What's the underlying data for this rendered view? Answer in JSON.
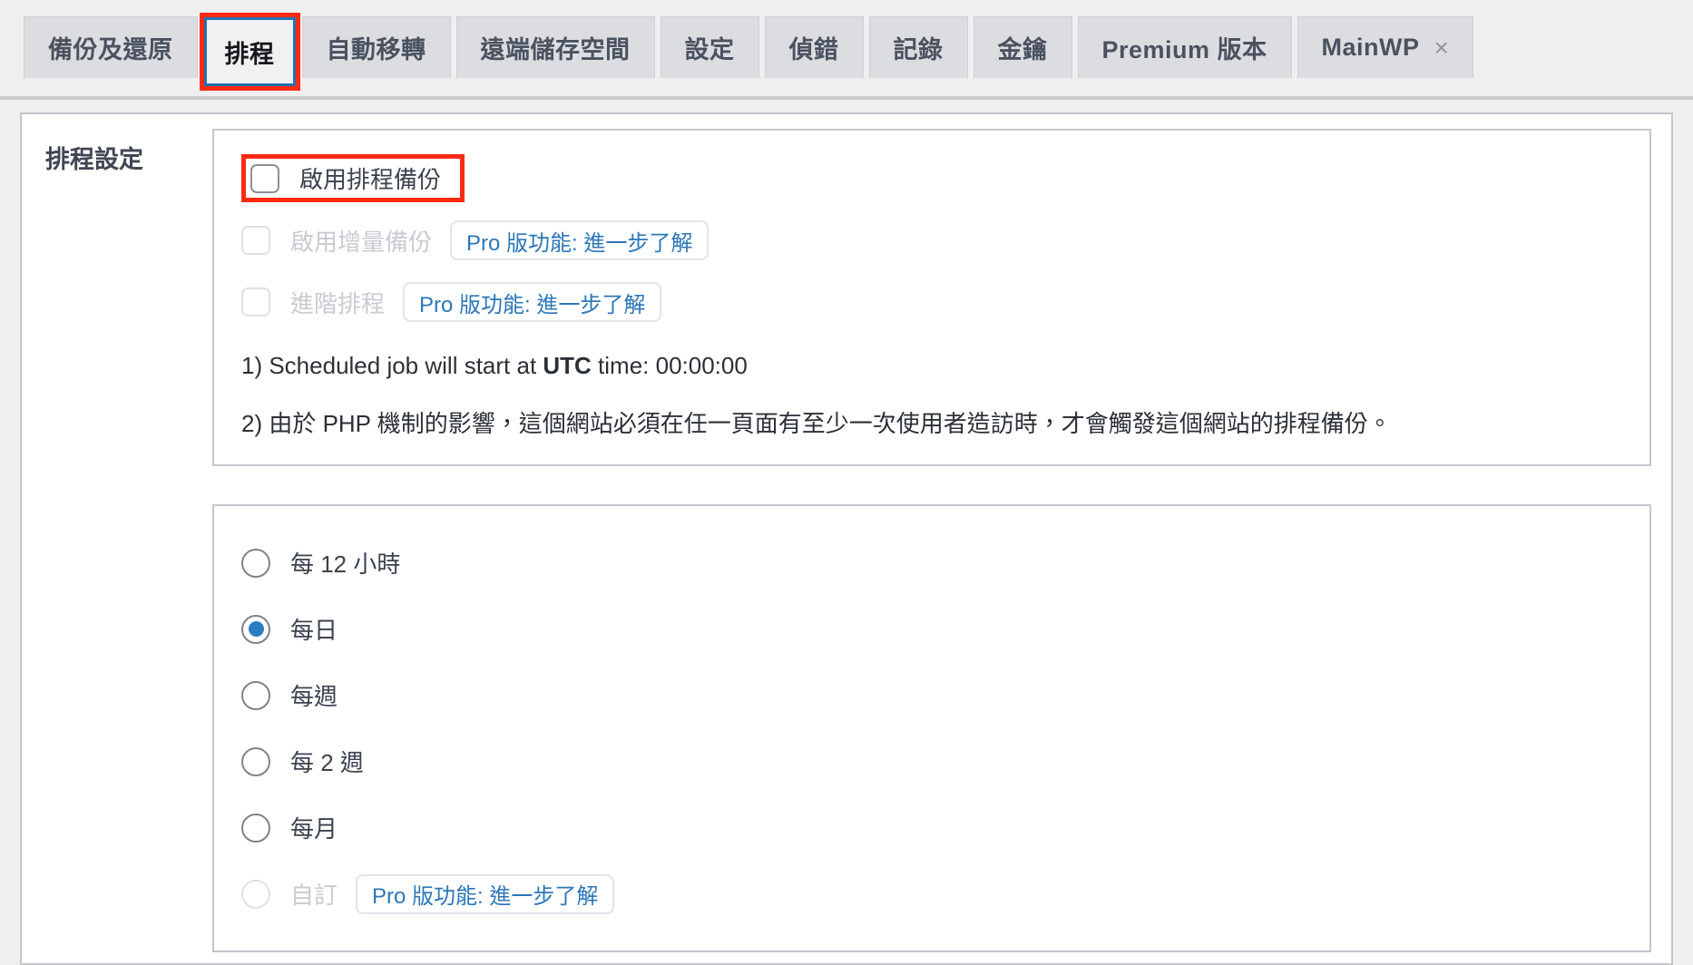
{
  "tabs": [
    {
      "label": "備份及還原",
      "active": false,
      "closable": false
    },
    {
      "label": "排程",
      "active": true,
      "closable": false
    },
    {
      "label": "自動移轉",
      "active": false,
      "closable": false
    },
    {
      "label": "遠端儲存空間",
      "active": false,
      "closable": false
    },
    {
      "label": "設定",
      "active": false,
      "closable": false
    },
    {
      "label": "偵錯",
      "active": false,
      "closable": false
    },
    {
      "label": "記錄",
      "active": false,
      "closable": false
    },
    {
      "label": "金鑰",
      "active": false,
      "closable": false
    },
    {
      "label": "Premium 版本",
      "active": false,
      "closable": false
    },
    {
      "label": "MainWP",
      "active": false,
      "closable": true
    }
  ],
  "close_icon": "×",
  "section": {
    "title": "排程設定"
  },
  "schedule_card": {
    "enable_backup": {
      "label": "啟用排程備份",
      "checked": false,
      "disabled": false,
      "highlighted": true
    },
    "incremental_backup": {
      "label": "啟用增量備份",
      "checked": false,
      "disabled": true,
      "pro_badge": "Pro 版功能: 進一步了解"
    },
    "advanced_schedule": {
      "label": "進階排程",
      "checked": false,
      "disabled": true,
      "pro_badge": "Pro 版功能: 進一步了解"
    },
    "note_1_prefix": "1) Scheduled job will start at ",
    "note_1_bold": "UTC",
    "note_1_suffix": " time: 00:00:00",
    "note_2": "2) 由於 PHP 機制的影響，這個網站必須在任一頁面有至少一次使用者造訪時，才會觸發這個網站的排程備份。"
  },
  "frequency_card": {
    "options": [
      {
        "label": "每 12 小時",
        "selected": false,
        "disabled": false,
        "pro_badge": null
      },
      {
        "label": "每日",
        "selected": true,
        "disabled": false,
        "pro_badge": null
      },
      {
        "label": "每週",
        "selected": false,
        "disabled": false,
        "pro_badge": null
      },
      {
        "label": "每 2 週",
        "selected": false,
        "disabled": false,
        "pro_badge": null
      },
      {
        "label": "每月",
        "selected": false,
        "disabled": false,
        "pro_badge": null
      },
      {
        "label": "自訂",
        "selected": false,
        "disabled": true,
        "pro_badge": "Pro 版功能: 進一步了解"
      }
    ]
  },
  "colors": {
    "accent_blue": "#2271b1",
    "annotation_red": "#ff2a16",
    "radio_selected": "#2c7dbf",
    "pro_link": "#2c77b8",
    "page_bg": "#efeff0",
    "tab_inactive_bg": "#dcdde0"
  }
}
